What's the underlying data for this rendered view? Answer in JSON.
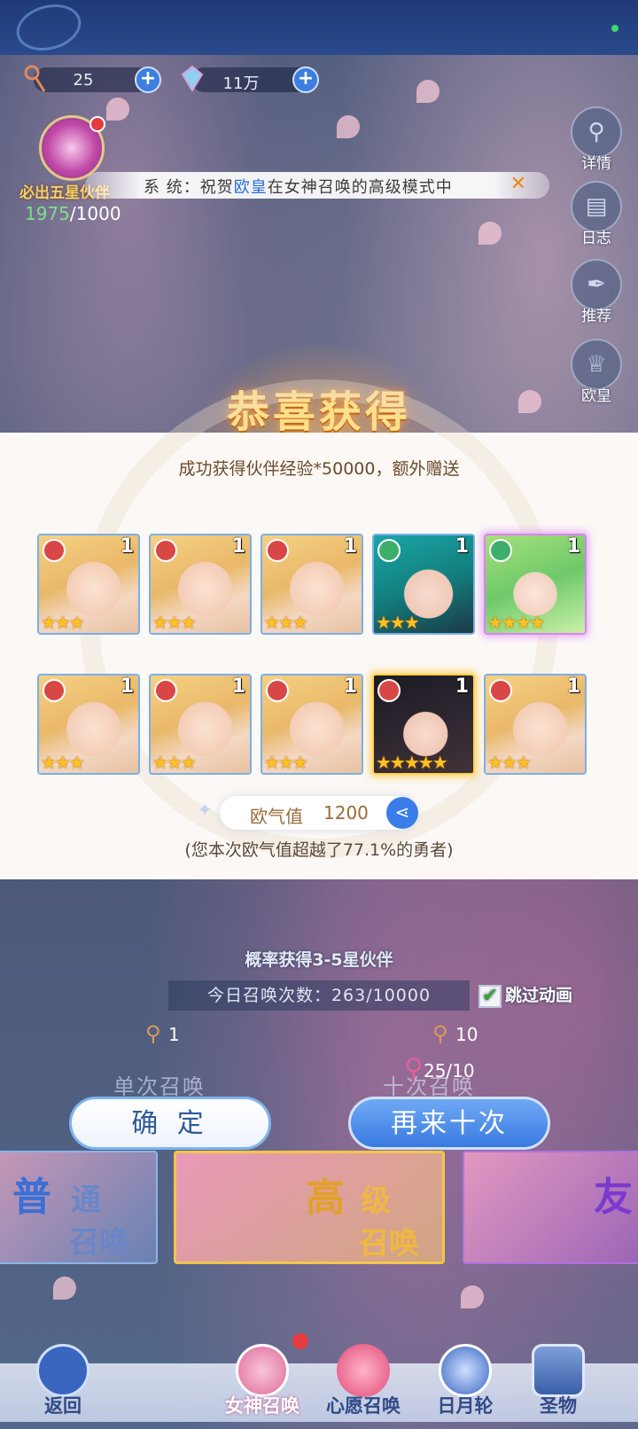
{
  "resources": {
    "keys": "25",
    "gems": "11万"
  },
  "guarantee": {
    "label": "必出五星伙伴",
    "current": "1975",
    "total": "/1000"
  },
  "broadcast": {
    "prefix": "系 统：祝贺",
    "player": "欧皇",
    "suffix": "在女神召唤的高级模式中",
    "close": "✕"
  },
  "side_menu": [
    {
      "label": "详情",
      "icon": "magnifier-icon"
    },
    {
      "label": "日志",
      "icon": "book-icon"
    },
    {
      "label": "推荐",
      "icon": "feather-icon"
    },
    {
      "label": "欧皇",
      "icon": "crown-icon"
    }
  ],
  "result": {
    "title": "恭喜获得",
    "subtitle": "成功获得伙伴经验*50000，额外赠送",
    "cards": [
      {
        "art": "blonde",
        "element": "fire",
        "level": "1",
        "stars": 3,
        "frame": "blue"
      },
      {
        "art": "blonde",
        "element": "fire",
        "level": "1",
        "stars": 3,
        "frame": "blue"
      },
      {
        "art": "blonde",
        "element": "fire",
        "level": "1",
        "stars": 3,
        "frame": "blue"
      },
      {
        "art": "teal",
        "element": "wind",
        "level": "1",
        "stars": 3,
        "frame": "blue"
      },
      {
        "art": "green",
        "element": "wind",
        "level": "1",
        "stars": 4,
        "frame": "purple"
      },
      {
        "art": "blonde",
        "element": "fire",
        "level": "1",
        "stars": 3,
        "frame": "blue"
      },
      {
        "art": "blonde",
        "element": "fire",
        "level": "1",
        "stars": 3,
        "frame": "blue"
      },
      {
        "art": "blonde",
        "element": "fire",
        "level": "1",
        "stars": 3,
        "frame": "blue"
      },
      {
        "art": "dark",
        "element": "fire",
        "level": "1",
        "stars": 5,
        "frame": "gold"
      },
      {
        "art": "blonde",
        "element": "fire",
        "level": "1",
        "stars": 3,
        "frame": "blue"
      }
    ],
    "luck_label": "欧气值",
    "luck_value": "1200",
    "luck_note": "(您本次欧气值超越了77.1%的勇者)"
  },
  "summon": {
    "probability": "概率获得3-5星伙伴",
    "today": "今日召唤次数：263/10000",
    "skip_label": "跳过动画",
    "skip_checked": true,
    "single_cost": "1",
    "ten_cost": "10",
    "owned": "25/10",
    "single_label": "单次召唤",
    "ten_label": "十次召唤",
    "confirm_label": "确 定",
    "again_label": "再来十次"
  },
  "modes": [
    {
      "big": "普",
      "small1": "通",
      "small2": "召唤"
    },
    {
      "big": "高",
      "small1": "级",
      "small2": "召唤"
    },
    {
      "big": "友",
      "small1": "",
      "small2": ""
    }
  ],
  "nav": {
    "back": "返回",
    "goddess": "女神召唤",
    "wish": "心愿召唤",
    "sunmoon": "日月轮",
    "relic": "圣物"
  },
  "colors": {
    "accent_blue": "#3a7ae0",
    "gold": "#ffc022",
    "title_gold": "#ffe08a"
  }
}
